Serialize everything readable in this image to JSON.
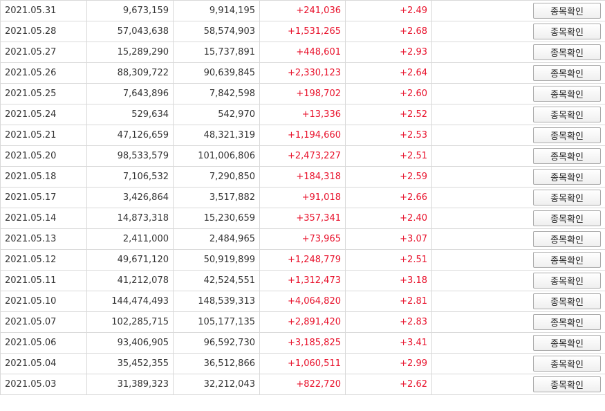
{
  "button_label": "종목확인",
  "colors": {
    "positive": "#e8102a",
    "border": "#d9d9d9",
    "text": "#333333"
  },
  "rows": [
    [
      "2021.05.31",
      "9,673,159",
      "9,914,195",
      "+241,036",
      "+2.49"
    ],
    [
      "2021.05.28",
      "57,043,638",
      "58,574,903",
      "+1,531,265",
      "+2.68"
    ],
    [
      "2021.05.27",
      "15,289,290",
      "15,737,891",
      "+448,601",
      "+2.93"
    ],
    [
      "2021.05.26",
      "88,309,722",
      "90,639,845",
      "+2,330,123",
      "+2.64"
    ],
    [
      "2021.05.25",
      "7,643,896",
      "7,842,598",
      "+198,702",
      "+2.60"
    ],
    [
      "2021.05.24",
      "529,634",
      "542,970",
      "+13,336",
      "+2.52"
    ],
    [
      "2021.05.21",
      "47,126,659",
      "48,321,319",
      "+1,194,660",
      "+2.53"
    ],
    [
      "2021.05.20",
      "98,533,579",
      "101,006,806",
      "+2,473,227",
      "+2.51"
    ],
    [
      "2021.05.18",
      "7,106,532",
      "7,290,850",
      "+184,318",
      "+2.59"
    ],
    [
      "2021.05.17",
      "3,426,864",
      "3,517,882",
      "+91,018",
      "+2.66"
    ],
    [
      "2021.05.14",
      "14,873,318",
      "15,230,659",
      "+357,341",
      "+2.40"
    ],
    [
      "2021.05.13",
      "2,411,000",
      "2,484,965",
      "+73,965",
      "+3.07"
    ],
    [
      "2021.05.12",
      "49,671,120",
      "50,919,899",
      "+1,248,779",
      "+2.51"
    ],
    [
      "2021.05.11",
      "41,212,078",
      "42,524,551",
      "+1,312,473",
      "+3.18"
    ],
    [
      "2021.05.10",
      "144,474,493",
      "148,539,313",
      "+4,064,820",
      "+2.81"
    ],
    [
      "2021.05.07",
      "102,285,715",
      "105,177,135",
      "+2,891,420",
      "+2.83"
    ],
    [
      "2021.05.06",
      "93,406,905",
      "96,592,730",
      "+3,185,825",
      "+3.41"
    ],
    [
      "2021.05.04",
      "35,452,355",
      "36,512,866",
      "+1,060,511",
      "+2.99"
    ],
    [
      "2021.05.03",
      "31,389,323",
      "32,212,043",
      "+822,720",
      "+2.62"
    ]
  ]
}
